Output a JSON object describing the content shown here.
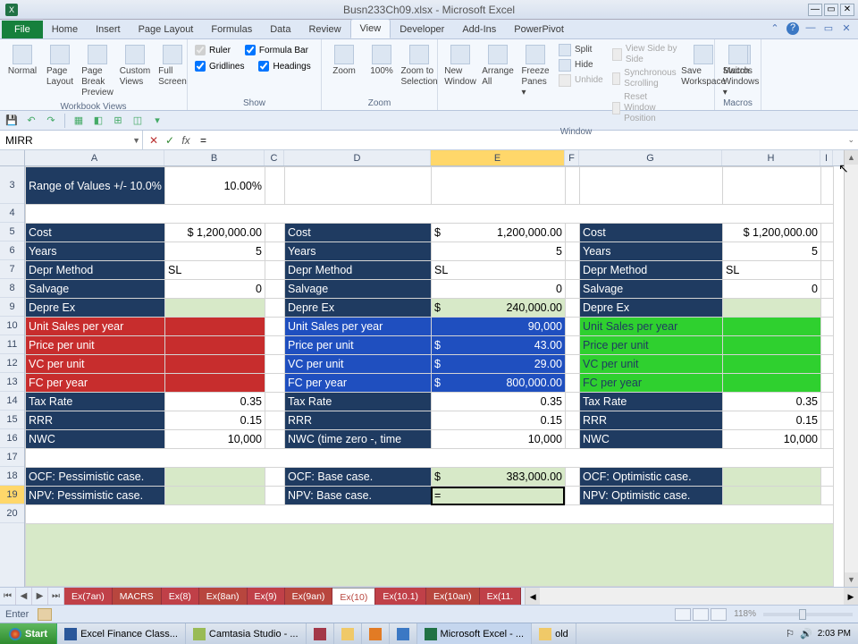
{
  "window": {
    "title": "Busn233Ch09.xlsx - Microsoft Excel"
  },
  "tabs": {
    "file": "File",
    "home": "Home",
    "insert": "Insert",
    "page_layout": "Page Layout",
    "formulas": "Formulas",
    "data": "Data",
    "review": "Review",
    "view": "View",
    "developer": "Developer",
    "addins": "Add-Ins",
    "powerpivot": "PowerPivot"
  },
  "ribbon": {
    "workbook_views": {
      "label": "Workbook Views",
      "normal": "Normal",
      "page_layout": "Page Layout",
      "page_break": "Page Break Preview",
      "custom_views": "Custom Views",
      "full_screen": "Full Screen"
    },
    "show": {
      "label": "Show",
      "ruler": "Ruler",
      "formula_bar": "Formula Bar",
      "gridlines": "Gridlines",
      "headings": "Headings"
    },
    "zoom": {
      "label": "Zoom",
      "zoom": "Zoom",
      "z100": "100%",
      "zoom_sel": "Zoom to Selection"
    },
    "window": {
      "label": "Window",
      "new_window": "New Window",
      "arrange_all": "Arrange All",
      "freeze": "Freeze Panes ▾",
      "split": "Split",
      "hide": "Hide",
      "unhide": "Unhide",
      "side_by_side": "View Side by Side",
      "sync_scroll": "Synchronous Scrolling",
      "reset_pos": "Reset Window Position",
      "save_ws": "Save Workspace",
      "switch": "Switch Windows ▾"
    },
    "macros": {
      "label": "Macros",
      "macros": "Macros"
    }
  },
  "namebox": "MIRR",
  "formula_bar": "=",
  "columns": {
    "A": "A",
    "B": "B",
    "C": "C",
    "D": "D",
    "E": "E",
    "F": "F",
    "G": "G",
    "H": "H",
    "I": "I"
  },
  "rows": {
    "r3": "3",
    "r4": "4",
    "r5": "5",
    "r6": "6",
    "r7": "7",
    "r8": "8",
    "r9": "9",
    "r10": "10",
    "r11": "11",
    "r12": "12",
    "r13": "13",
    "r14": "14",
    "r15": "15",
    "r16": "16",
    "r17": "17",
    "r18": "18",
    "r19": "19",
    "r20": "20"
  },
  "cells": {
    "A3": "Range of Values +/- 10.0%",
    "B3": "10.00%",
    "A5": "Cost",
    "B5": "$  1,200,000.00",
    "A6": "Years",
    "B6v": "5",
    "A7": "Depr Method",
    "B7": "SL",
    "A8": "Salvage",
    "B8v": "0",
    "A9": "Depre Ex",
    "A10": "Unit Sales per year",
    "A11": "Price per unit",
    "A12": "VC per unit",
    "A13": "FC per year",
    "A14": "Tax Rate",
    "B14v": "0.35",
    "A15": "RRR",
    "B15v": "0.15",
    "A16": "NWC",
    "B16v": "10,000",
    "A18": "OCF: Pessimistic case.",
    "A19": "NPV: Pessimistic case.",
    "D5": "Cost",
    "E5d": "$",
    "E5v": "1,200,000.00",
    "D6": "Years",
    "E6v": "5",
    "D7": "Depr Method",
    "E7": "SL",
    "D8": "Salvage",
    "E8v": "0",
    "D9": "Depre Ex",
    "E9d": "$",
    "E9v": "240,000.00",
    "D10": "Unit Sales per year",
    "E10v": "90,000",
    "D11": "Price per unit",
    "E11d": "$",
    "E11v": "43.00",
    "D12": "VC per unit",
    "E12d": "$",
    "E12v": "29.00",
    "D13": "FC per year",
    "E13d": "$",
    "E13v": "800,000.00",
    "D14": "Tax Rate",
    "E14v": "0.35",
    "D15": "RRR",
    "E15v": "0.15",
    "D16": "NWC (time zero -, time",
    "E16v": "10,000",
    "D18": "OCF: Base case.",
    "E18d": "$",
    "E18v": "383,000.00",
    "D19": "NPV: Base case.",
    "E19": "=",
    "G5": "Cost",
    "H5": "$ 1,200,000.00",
    "G6": "Years",
    "H6v": "5",
    "G7": "Depr Method",
    "H7": "SL",
    "G8": "Salvage",
    "H8v": "0",
    "G9": "Depre Ex",
    "G10": "Unit Sales per year",
    "G11": "Price per unit",
    "G12": "VC per unit",
    "G13": "FC per year",
    "G14": "Tax Rate",
    "H14v": "0.35",
    "G15": "RRR",
    "H15v": "0.15",
    "G16": "NWC",
    "H16v": "10,000",
    "G18": "OCF: Optimistic case.",
    "G19": "NPV: Optimistic case."
  },
  "sheet_tabs": {
    "t1": "Ex(7an)",
    "t2": "MACRS",
    "t3": "Ex(8)",
    "t4": "Ex(8an)",
    "t5": "Ex(9)",
    "t6": "Ex(9an)",
    "t7": "Ex(10)",
    "t8": "Ex(10.1)",
    "t9": "Ex(10an)",
    "t10": "Ex(11."
  },
  "status": {
    "mode": "Enter",
    "zoom": "118%"
  },
  "taskbar": {
    "start": "Start",
    "b1": "Excel Finance Class...",
    "b2": "Camtasia Studio - ...",
    "b3": "Microsoft Excel - ...",
    "b4": "old",
    "clock": "2:03 PM"
  }
}
